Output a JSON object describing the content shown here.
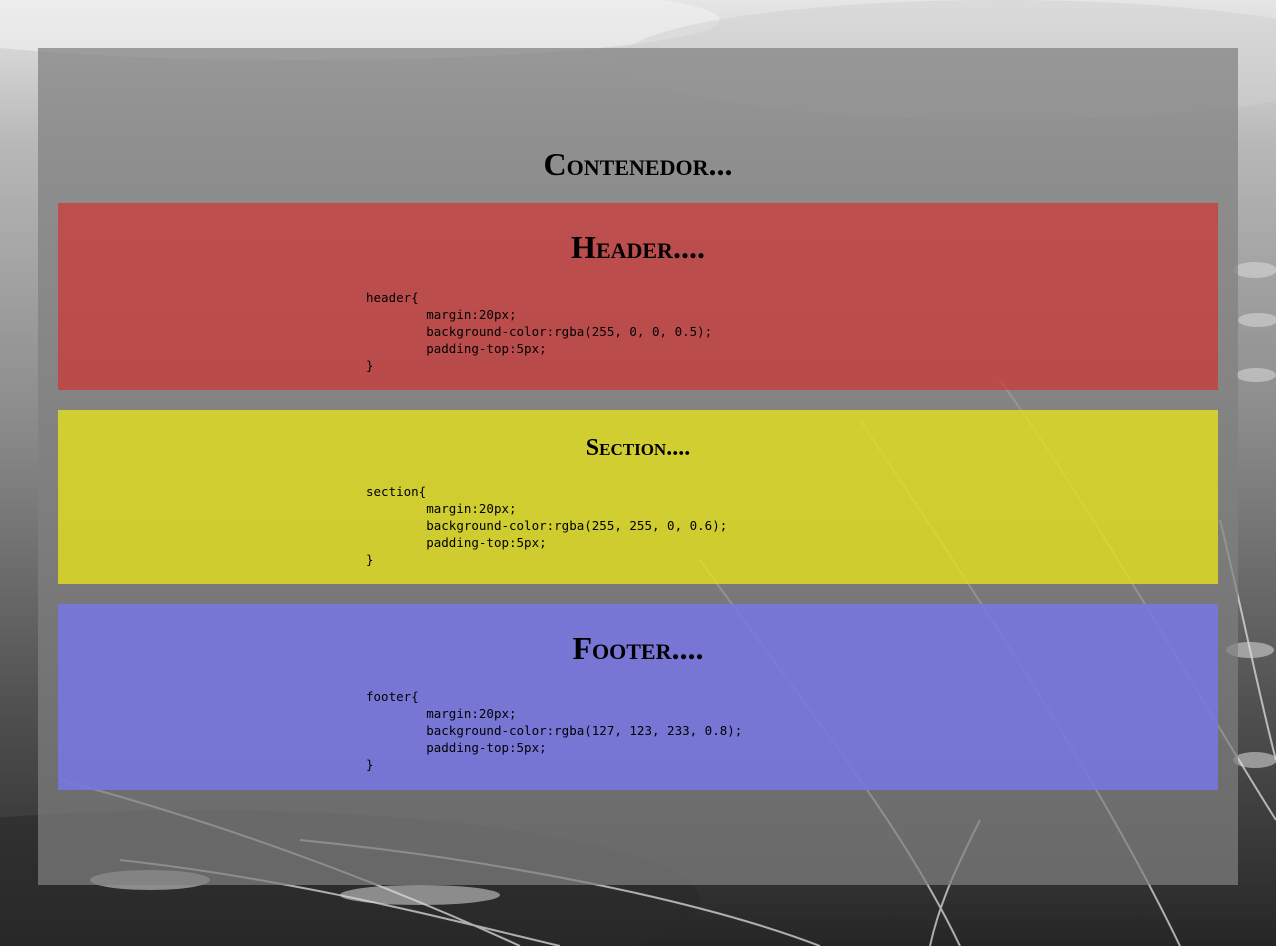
{
  "container": {
    "title": "Contenedor..."
  },
  "header": {
    "title": "Header....",
    "code": "header{\n\tmargin:20px;\n\tbackground-color:rgba(255, 0, 0, 0.5);\n\tpadding-top:5px;\n}",
    "color": "#c94444"
  },
  "section": {
    "title": "Section....",
    "code": "section{\n\tmargin:20px;\n\tbackground-color:rgba(255, 255, 0, 0.6);\n\tpadding-top:5px;\n}",
    "color": "#d4d433"
  },
  "footer": {
    "title": "Footer....",
    "code": "footer{\n\tmargin:20px;\n\tbackground-color:rgba(127, 123, 233, 0.8);\n\tpadding-top:5px;\n}",
    "color": "#7e79d6"
  }
}
